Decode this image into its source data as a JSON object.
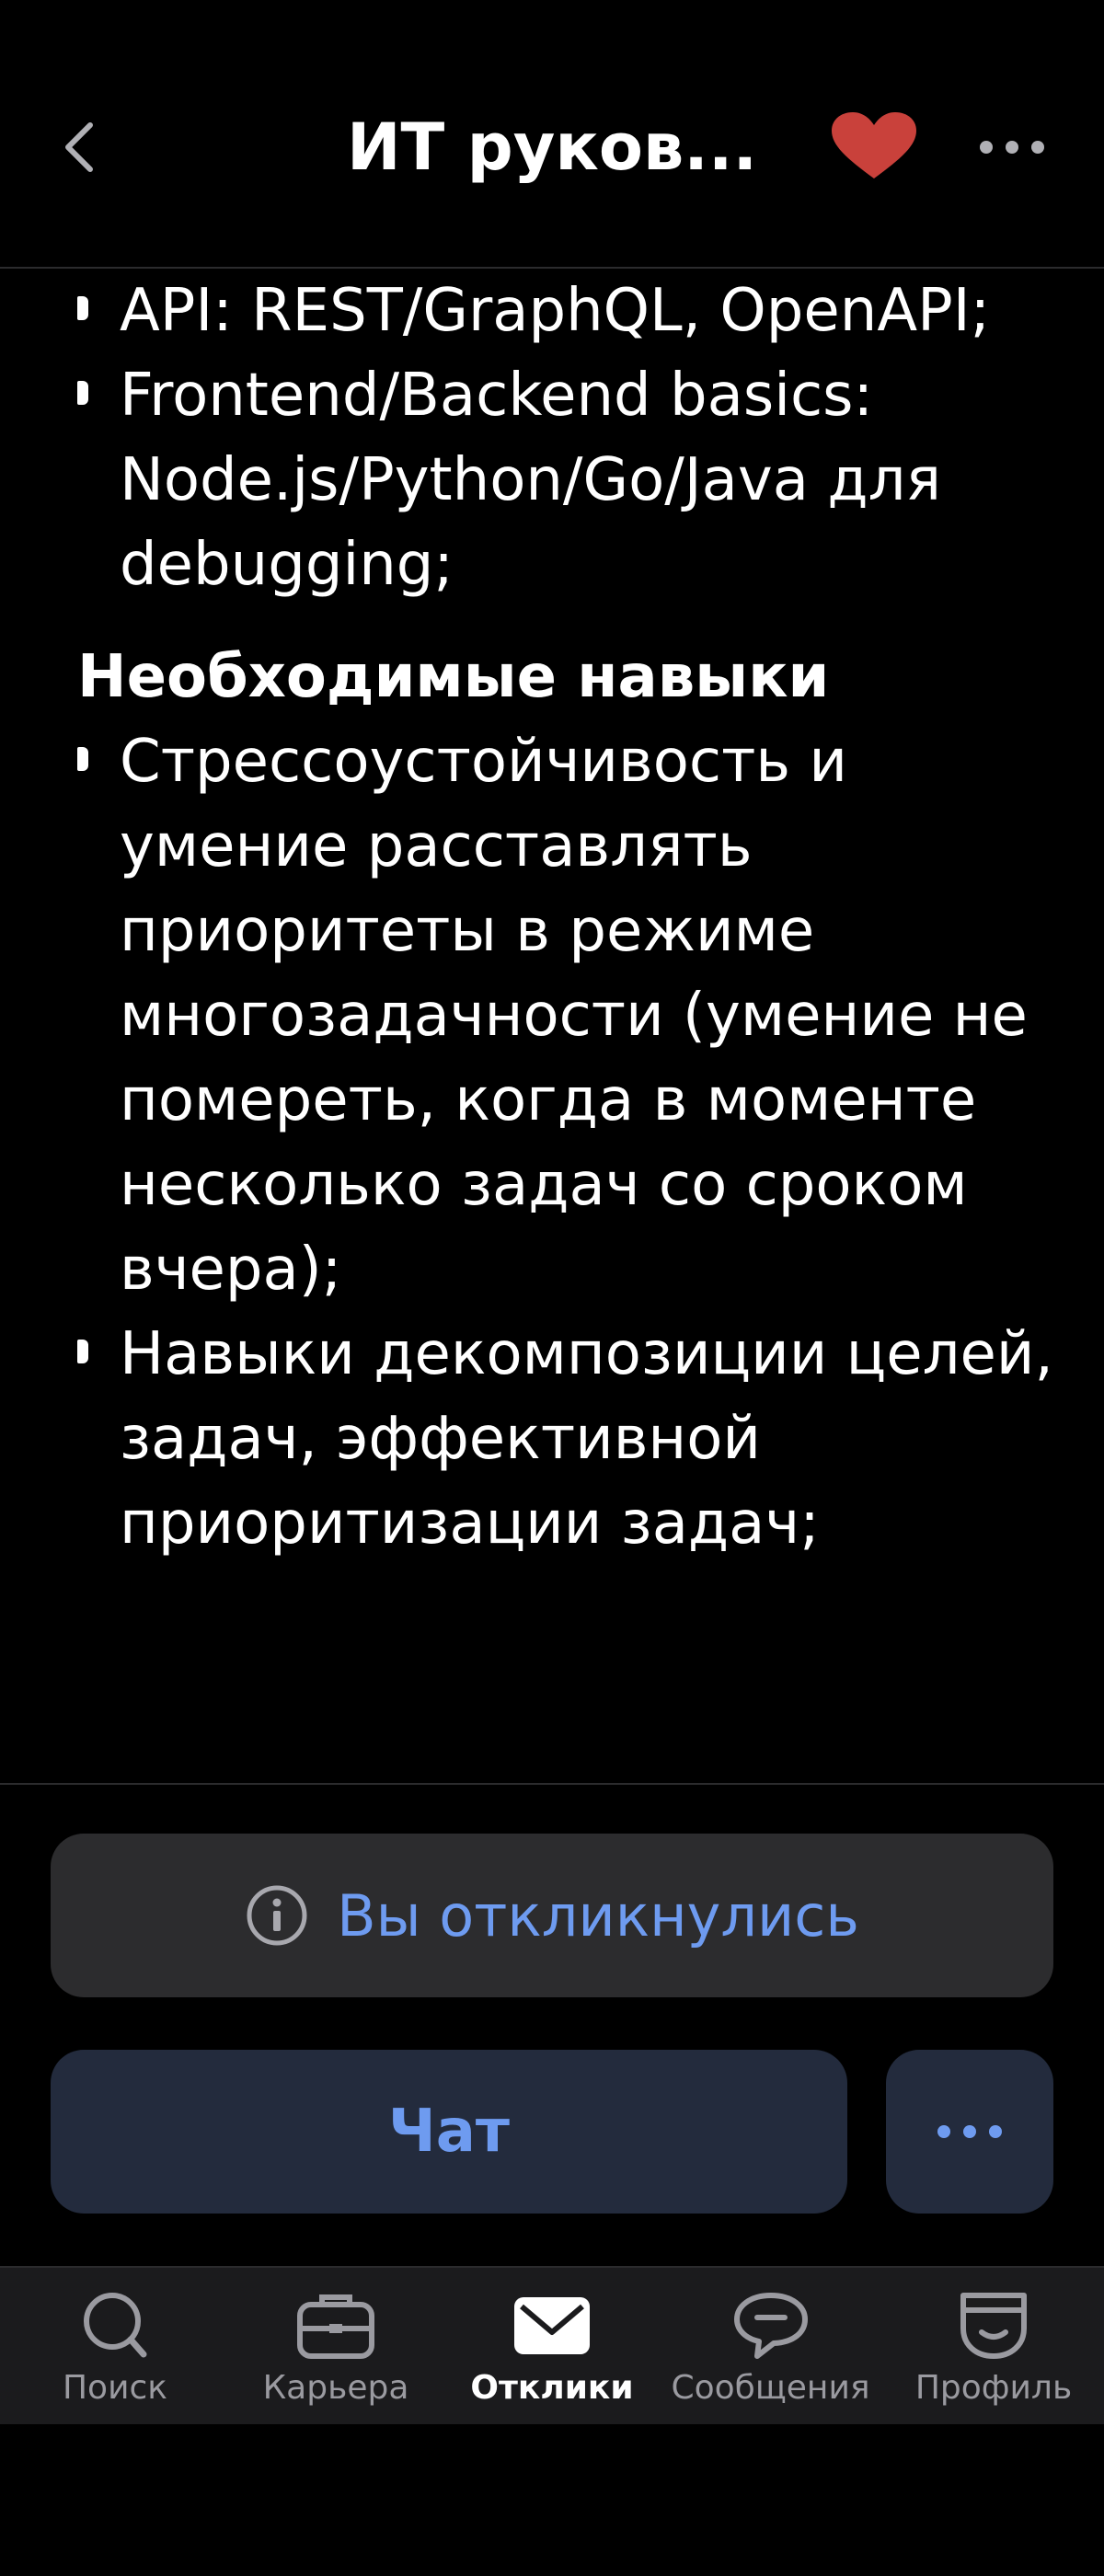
{
  "header": {
    "title": "ИТ руков...",
    "back_icon": "chevron-left-icon",
    "favorite_icon": "heart-icon",
    "favorite_color": "#c9413b",
    "more_icon": "ellipsis-icon"
  },
  "content": {
    "list_top": [
      "API: REST/GraphQL, OpenAPI;",
      "Frontend/Backend basics: Node.js/Python/Go/Java для debugging;"
    ],
    "section_title": "Необходимые навыки",
    "list_skills": [
      "Стрессоустойчивость и умение расставлять приоритеты в режиме многозадачности (умение не помереть, когда в моменте несколько задач со сроком вчера);",
      "Навыки декомпозиции целей, задач, эффективной приоритизации задач;"
    ]
  },
  "actions": {
    "responded_label": "Вы откликнулись",
    "responded_icon": "info-icon",
    "chat_label": "Чат",
    "chat_more_icon": "ellipsis-icon",
    "accent_color": "#6e9bf0"
  },
  "tabbar": {
    "tabs": [
      {
        "label": "Поиск",
        "icon": "search-icon"
      },
      {
        "label": "Карьера",
        "icon": "briefcase-icon"
      },
      {
        "label": "Отклики",
        "icon": "envelope-icon",
        "active": true
      },
      {
        "label": "Сообщения",
        "icon": "chat-bubble-icon"
      },
      {
        "label": "Профиль",
        "icon": "profile-icon"
      }
    ]
  }
}
